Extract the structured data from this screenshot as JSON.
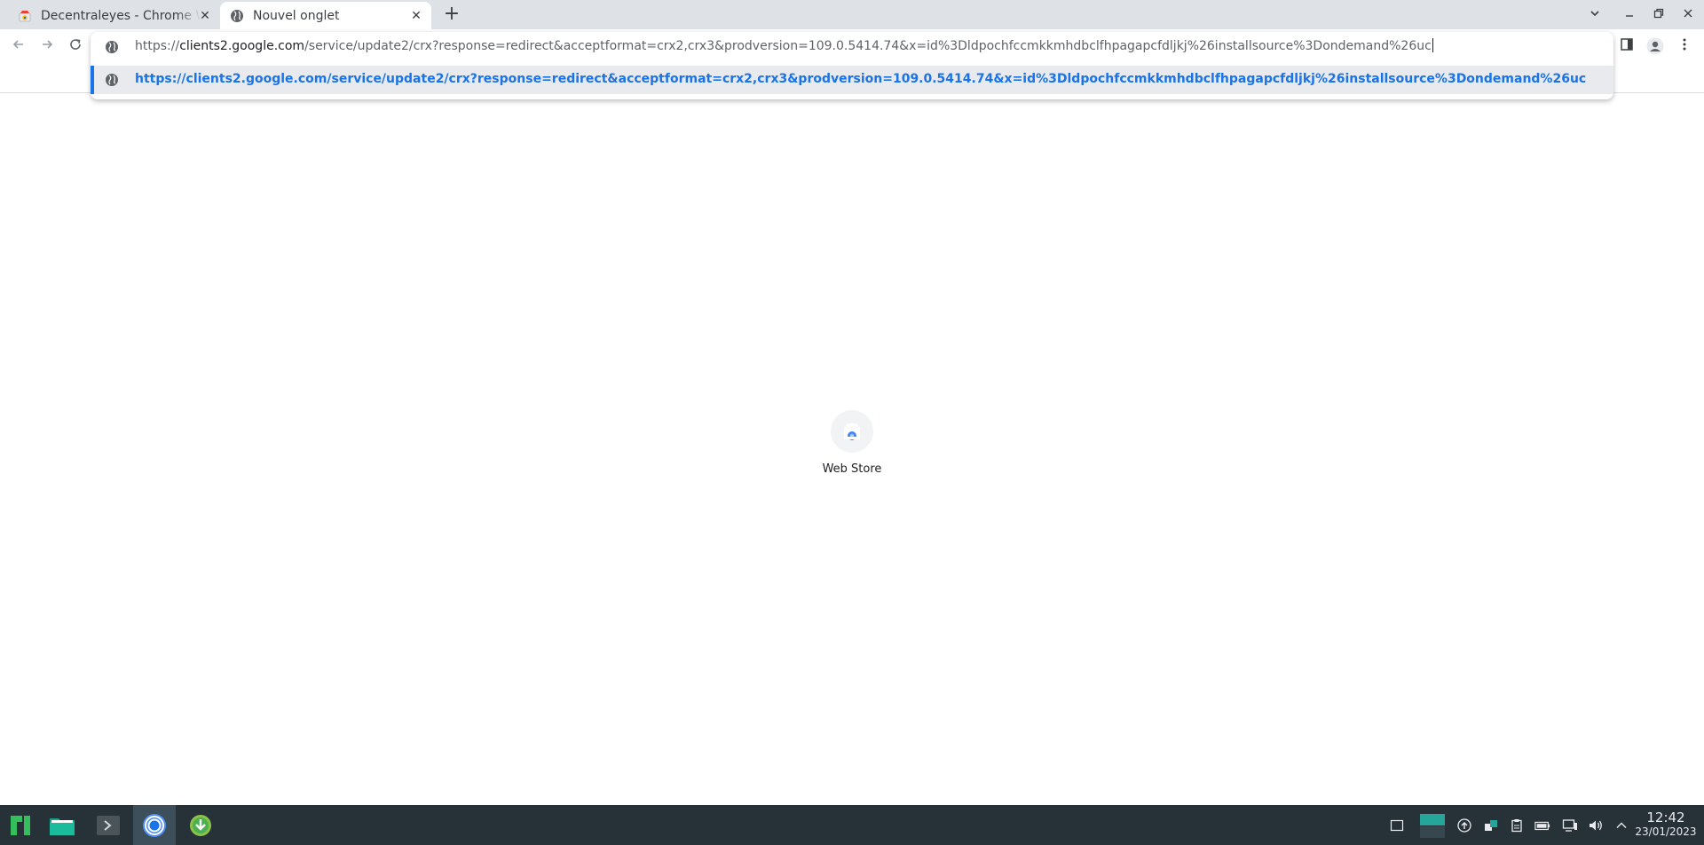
{
  "tabs": [
    {
      "title": "Decentraleyes - Chrome Web Store",
      "active": false,
      "favicon": "chrome-web-store-icon"
    },
    {
      "title": "Nouvel onglet",
      "active": true,
      "favicon": "globe-icon"
    }
  ],
  "omnibox": {
    "input_prefix": "https://",
    "input_host": "clients2.google.com",
    "input_path": "/service/update2/crx?response=redirect&acceptformat=crx2,crx3&prodversion=109.0.5414.74&x=id%3Dldpochfccmkkmhdbclfhpagapcfdljkj%26installsource%3Dondemand%26uc",
    "suggestion": "https://clients2.google.com/service/update2/crx?response=redirect&acceptformat=crx2,crx3&prodversion=109.0.5414.74&x=id%3Dldpochfccmkkmhdbclfhpagapcfdljkj%26installsource%3Dondemand%26uc"
  },
  "shortcuts": [
    {
      "label": "Web Store",
      "icon": "web-store-icon"
    }
  ],
  "taskbar": {
    "time": "12:42",
    "date": "23/01/2023"
  },
  "colors": {
    "accent": "#1a73e8",
    "taskbar": "#263238",
    "tabstrip": "#dee1e6",
    "manjaro_green": "#35bf5c"
  }
}
